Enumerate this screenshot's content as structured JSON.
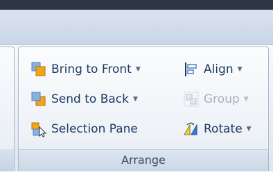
{
  "ribbon": {
    "group_label": "Arrange",
    "buttons": {
      "bring_to_front": {
        "label": "Bring to Front",
        "dropdown": "▼",
        "icon": "bring-to-front-icon"
      },
      "send_to_back": {
        "label": "Send to Back",
        "dropdown": "▼",
        "icon": "send-to-back-icon"
      },
      "selection_pane": {
        "label": "Selection Pane",
        "icon": "selection-pane-icon"
      },
      "align": {
        "label": "Align",
        "dropdown": "▼",
        "icon": "align-icon"
      },
      "group": {
        "label": "Group",
        "dropdown": "▼",
        "icon": "group-icon",
        "enabled": false
      },
      "rotate": {
        "label": "Rotate",
        "dropdown": "▼",
        "icon": "rotate-icon"
      }
    }
  },
  "colors": {
    "title_bar": "#2f3545",
    "text": "#1d3a63",
    "disabled_text": "#a6afba",
    "icon_orange": "#f2a51b",
    "icon_blue": "#4d7fc4"
  }
}
